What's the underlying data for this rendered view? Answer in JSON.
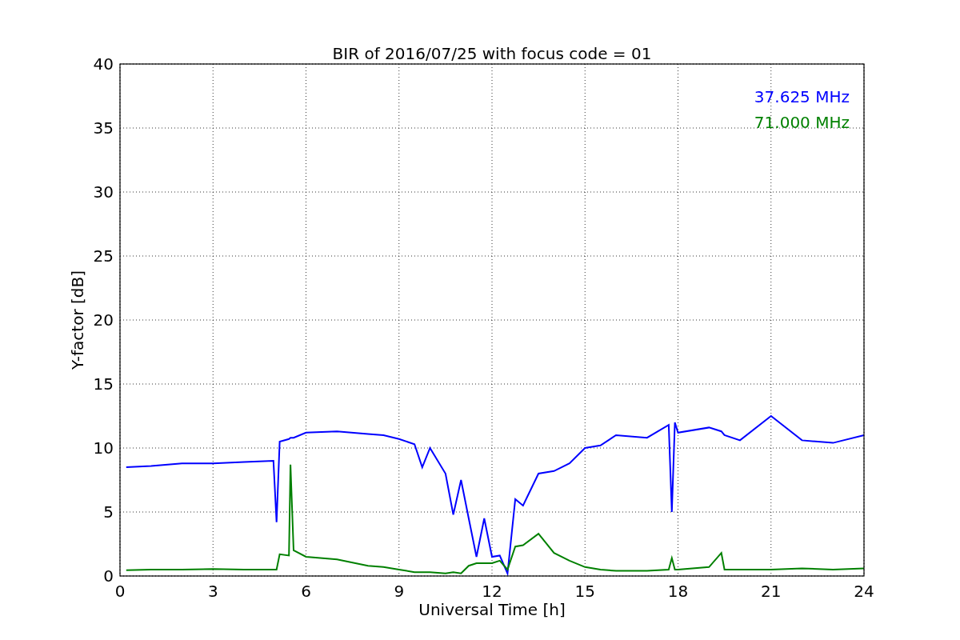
{
  "chart_data": {
    "type": "line",
    "title": "BIR of 2016/07/25 with focus code = 01",
    "xlabel": "Universal Time [h]",
    "ylabel": "Y-factor [dB]",
    "x": [
      0.2,
      1,
      2,
      3,
      4,
      4.95,
      5.05,
      5.15,
      5.45,
      5.5,
      5.6,
      6,
      7,
      8,
      8.5,
      9,
      9.5,
      9.75,
      10,
      10.5,
      10.75,
      11,
      11.25,
      11.5,
      11.75,
      12,
      12.25,
      12.5,
      12.75,
      13,
      13.5,
      14,
      14.5,
      15,
      15.5,
      16,
      17,
      17.7,
      17.8,
      17.9,
      18,
      19,
      19.4,
      19.5,
      20,
      21,
      22,
      23,
      24
    ],
    "series": [
      {
        "name": "37.625 MHz",
        "color": "#0000ff",
        "values": [
          8.5,
          8.6,
          8.8,
          8.8,
          8.9,
          9.0,
          4.2,
          10.5,
          10.7,
          10.8,
          10.8,
          11.2,
          11.3,
          11.1,
          11.0,
          10.7,
          10.3,
          8.5,
          10.0,
          8.0,
          4.8,
          7.5,
          4.5,
          1.5,
          4.5,
          1.5,
          1.6,
          0.2,
          6.0,
          5.5,
          8.0,
          8.2,
          8.8,
          10.0,
          10.2,
          11.0,
          10.8,
          11.8,
          5.0,
          12.0,
          11.2,
          11.6,
          11.3,
          11.0,
          10.6,
          12.5,
          10.6,
          10.4,
          11.0
        ]
      },
      {
        "name": "71.000 MHz",
        "color": "#008000",
        "values": [
          0.45,
          0.5,
          0.5,
          0.55,
          0.5,
          0.5,
          0.5,
          1.7,
          1.6,
          8.7,
          2.0,
          1.5,
          1.3,
          0.8,
          0.7,
          0.5,
          0.3,
          0.3,
          0.3,
          0.2,
          0.3,
          0.2,
          0.8,
          1.0,
          1.0,
          1.0,
          1.2,
          0.5,
          2.3,
          2.4,
          3.3,
          1.8,
          1.2,
          0.7,
          0.5,
          0.4,
          0.4,
          0.5,
          1.4,
          0.5,
          0.5,
          0.7,
          1.8,
          0.5,
          0.5,
          0.5,
          0.6,
          0.5,
          0.6
        ]
      }
    ],
    "xlim": [
      0,
      24
    ],
    "ylim": [
      0,
      40
    ],
    "grid": true,
    "xticks": [
      0,
      3,
      6,
      9,
      12,
      15,
      18,
      21,
      24
    ],
    "yticks": [
      0,
      5,
      10,
      15,
      20,
      25,
      30,
      35,
      40
    ]
  }
}
